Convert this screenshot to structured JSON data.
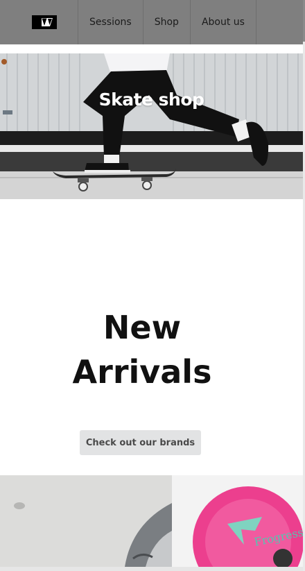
{
  "nav": {
    "logo_alt": "logo",
    "items": [
      {
        "label": "Sessions"
      },
      {
        "label": "Shop"
      },
      {
        "label": "About us"
      }
    ]
  },
  "hero": {
    "title": "Skate shop"
  },
  "arrivals": {
    "line1": "New",
    "line2": "Arrivals",
    "button_label": "Check out our brands"
  },
  "colors": {
    "navbar": "#7f7f7f",
    "button_bg": "#e2e3e4",
    "heading": "#111111"
  },
  "icons": [
    "volcom-stone-logo"
  ]
}
